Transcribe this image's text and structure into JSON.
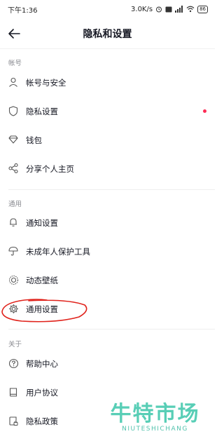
{
  "status_bar": {
    "time": "下午1:36",
    "speed": "3.0K/s",
    "battery": "86"
  },
  "header": {
    "title": "隐私和设置"
  },
  "sections": {
    "account": {
      "title": "帐号",
      "items": [
        {
          "label": "帐号与安全",
          "icon": "person-icon"
        },
        {
          "label": "隐私设置",
          "icon": "shield-icon"
        },
        {
          "label": "钱包",
          "icon": "diamond-icon"
        },
        {
          "label": "分享个人主页",
          "icon": "share-icon"
        }
      ]
    },
    "general": {
      "title": "通用",
      "items": [
        {
          "label": "通知设置",
          "icon": "bell-icon"
        },
        {
          "label": "未成年人保护工具",
          "icon": "umbrella-icon"
        },
        {
          "label": "动态壁纸",
          "icon": "wallpaper-icon"
        },
        {
          "label": "通用设置",
          "icon": "gear-icon"
        }
      ]
    },
    "about": {
      "title": "关于",
      "items": [
        {
          "label": "帮助中心",
          "icon": "help-icon"
        },
        {
          "label": "用户协议",
          "icon": "book-icon"
        },
        {
          "label": "隐私政策",
          "icon": "lock-doc-icon"
        }
      ]
    }
  },
  "colors": {
    "accent_dot": "#fe2c55",
    "annotation": "#e0221b",
    "watermark": "#2fc3a5"
  },
  "watermark": {
    "cn": "牛特市场",
    "en": "NIUTESHICHANG"
  }
}
